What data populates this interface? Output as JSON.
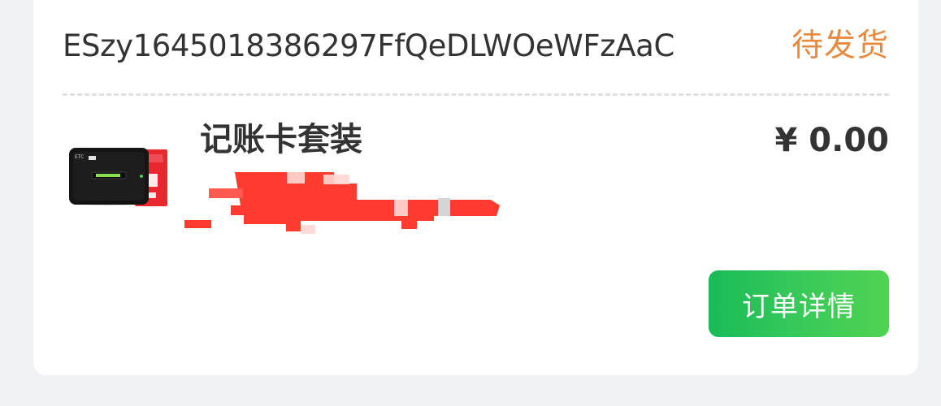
{
  "order": {
    "number": "ESzy1645018386297FfQeDLWOeWFzAaC",
    "status": "待发货"
  },
  "product": {
    "name": "记账卡套装",
    "price": "¥ 0.00",
    "image_icon": "device-with-card-image"
  },
  "actions": {
    "details_label": "订单详情"
  },
  "colors": {
    "status": "#e8893d",
    "button_start": "#18bb57",
    "button_end": "#50d352",
    "redaction": "#ff3b30"
  }
}
